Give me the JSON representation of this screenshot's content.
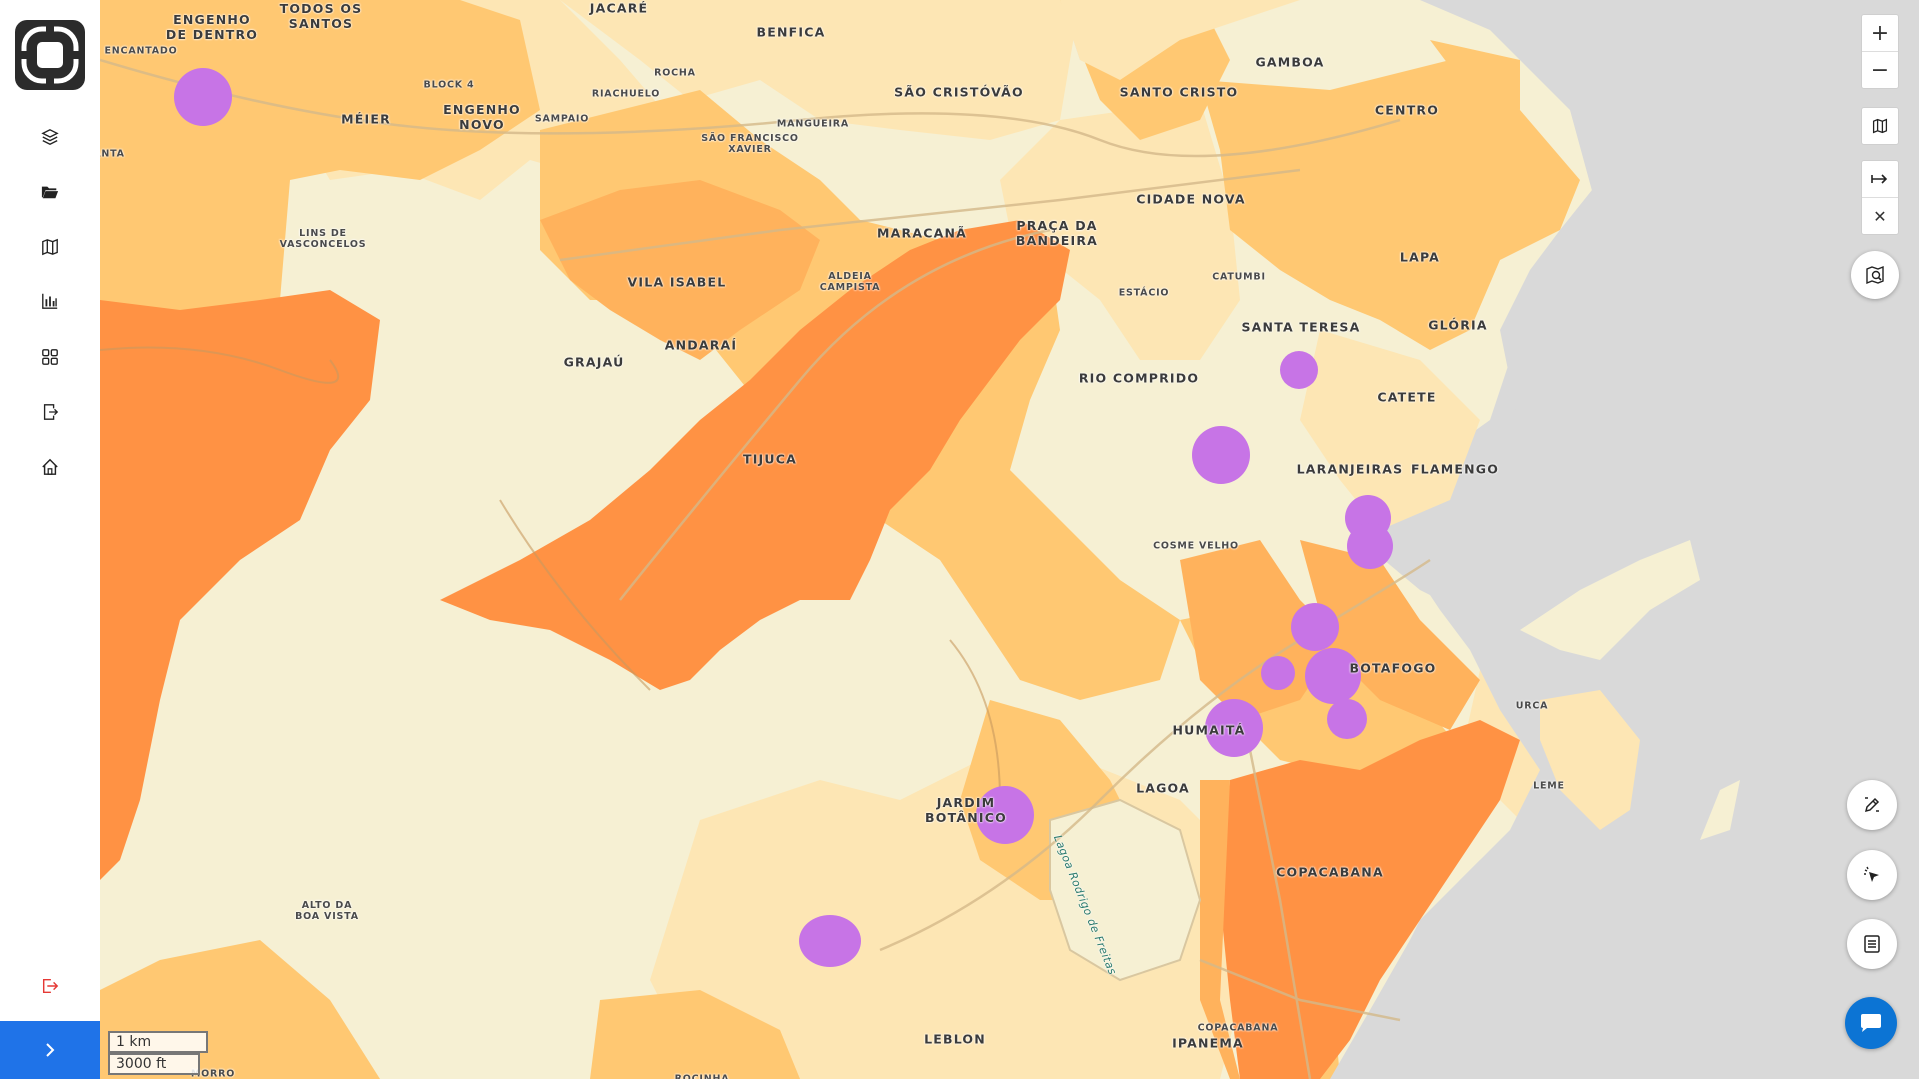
{
  "sidebar": {
    "logo": "platform-logo",
    "items": [
      {
        "name": "layers",
        "icon": "layers-icon"
      },
      {
        "name": "folder",
        "icon": "folder-open-icon"
      },
      {
        "name": "map",
        "icon": "map-icon"
      },
      {
        "name": "charts",
        "icon": "bar-chart-icon"
      },
      {
        "name": "apps",
        "icon": "grid-icon"
      },
      {
        "name": "export",
        "icon": "export-icon"
      },
      {
        "name": "home",
        "icon": "home-icon"
      }
    ],
    "logout_icon": "logout-icon",
    "expand_icon": "chevron-right-icon"
  },
  "map": {
    "neighborhoods": [
      "ENGENHO\nDE DENTRO",
      "TODOS OS\nSANTOS",
      "JACARÉ",
      "BENFICA",
      "GAMBOA",
      "ENCANTADO",
      "BLOCK 4",
      "ROCHA",
      "RIACHUELO",
      "SÃO CRISTÓVÃO",
      "SANTO CRISTO",
      "CENTRO",
      "MÉIER",
      "ENGENHO\nNOVO",
      "SAMPAIO",
      "MANGUEIRA",
      "SÃO FRANCISCO\nXAVIER",
      "ANTA",
      "CIDADE NOVA",
      "MARACANÃ",
      "PRAÇA DA\nBANDEIRA",
      "LINS DE\nVASCONCELOS",
      "LAPA",
      "VILA ISABEL",
      "ALDEIA\nCAMPISTA",
      "ESTÁCIO",
      "CATUMBI",
      "GLÓRIA",
      "SANTA TERESA",
      "ANDARAÍ",
      "GRAJAÚ",
      "RIO COMPRIDO",
      "CATETE",
      "TIJUCA",
      "LARANJEIRAS",
      "FLAMENGO",
      "COSME VELHO",
      "BOTAFOGO",
      "URCA",
      "HUMAITÁ",
      "LAGOA",
      "JARDIM\nBOTÂNICO",
      "LEME",
      "COPACABANA",
      "ALTO DA\nBOA VISTA",
      "LEBLON",
      "IPANEMA",
      "COPACABANA",
      "MORRO",
      "ROCINHA"
    ],
    "water_label": "Lagoa Rodrigo de Freitas",
    "colors": {
      "level1": "#f6f0d3",
      "level2": "#fde6b4",
      "level3": "#ffc872",
      "level4": "#ffb25c",
      "level5": "#ff9244",
      "points": "#c774e6",
      "sea": "#d9d9d9"
    }
  },
  "controls": {
    "zoom_in": "+",
    "zoom_out": "−",
    "basemap_icon": "map-icon",
    "measure_icon": "arrow-to-right-icon",
    "close": "✕",
    "map_search_icon": "map-search-icon",
    "edit_icon": "draw-edit-icon",
    "select_icon": "cursor-select-icon",
    "table_icon": "table-icon",
    "chat_icon": "chat-bubble-icon"
  },
  "scale": {
    "metric": "1 km",
    "imperial": "3000 ft"
  }
}
